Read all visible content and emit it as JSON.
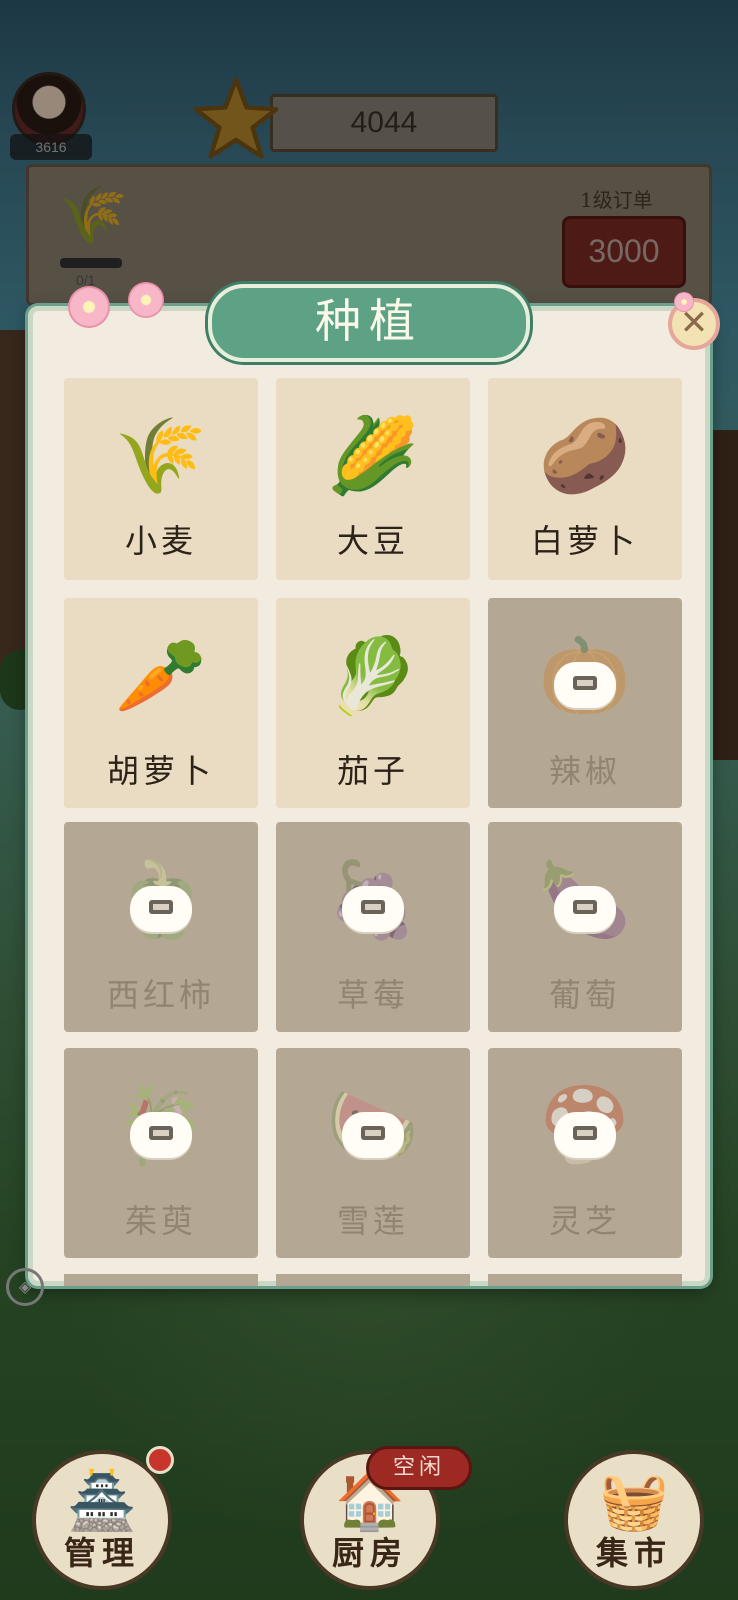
{
  "player": {
    "level_text": "3616",
    "coins": "4044"
  },
  "order": {
    "label": "1级订单",
    "reward": "3000",
    "progress_text": "0/1",
    "item_icon": "wheat-icon"
  },
  "panel": {
    "title": "种植",
    "close_glyph": "✕",
    "crops": [
      {
        "name": "小麦",
        "icon": "🌾",
        "icon_name": "wheat-icon",
        "locked": false
      },
      {
        "name": "大豆",
        "icon": "🌽",
        "icon_name": "corn-icon",
        "locked": false
      },
      {
        "name": "白萝卜",
        "icon": "🥔",
        "icon_name": "potato-icon",
        "locked": false
      },
      {
        "name": "胡萝卜",
        "icon": "🥕",
        "icon_name": "carrot-icon",
        "locked": false
      },
      {
        "name": "茄子",
        "icon": "🥬",
        "icon_name": "lettuce-icon",
        "locked": false
      },
      {
        "name": "辣椒",
        "icon": "🎃",
        "icon_name": "pumpkin-icon",
        "locked": true
      },
      {
        "name": "西红柿",
        "icon": "🫑",
        "icon_name": "pepper-icon",
        "locked": true
      },
      {
        "name": "草莓",
        "icon": "🍇",
        "icon_name": "grape-icon",
        "locked": true
      },
      {
        "name": "葡萄",
        "icon": "🍆",
        "icon_name": "eggplant-icon",
        "locked": true
      },
      {
        "name": "茱萸",
        "icon": "🎋",
        "icon_name": "sugarcane-icon",
        "locked": true
      },
      {
        "name": "雪莲",
        "icon": "🍉",
        "icon_name": "watermelon-icon",
        "locked": true
      },
      {
        "name": "灵芝",
        "icon": "🍄",
        "icon_name": "mushroom-icon",
        "locked": true
      }
    ]
  },
  "nav": {
    "manage": {
      "label": "管理",
      "icon": "🏯",
      "has_notification": true
    },
    "kitchen": {
      "label": "厨房",
      "icon": "🏠",
      "status": "空闲"
    },
    "market": {
      "label": "集市",
      "icon": "🧺"
    }
  },
  "colors": {
    "panel_green": "#5da285",
    "locked_cell": "#b4a894",
    "unlocked_cell": "#eadbc3",
    "badge_red": "#9c2a22"
  }
}
